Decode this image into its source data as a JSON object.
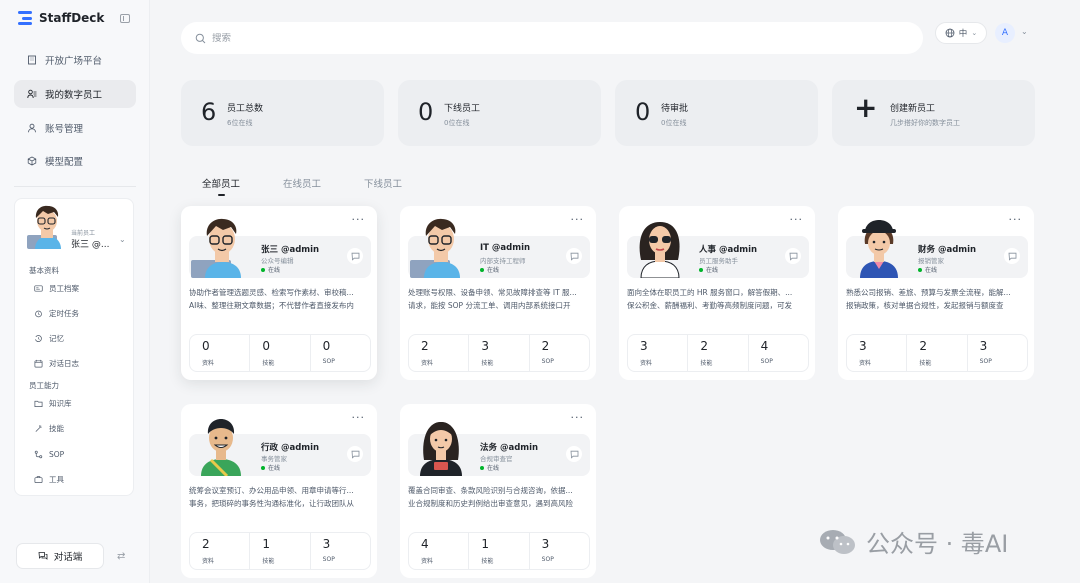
{
  "brand": {
    "name": "StaffDeck"
  },
  "sidebar": {
    "nav": [
      {
        "label": "开放广场平台",
        "icon": "building-icon",
        "active": false
      },
      {
        "label": "我的数字员工",
        "icon": "users-icon",
        "active": true
      },
      {
        "label": "账号管理",
        "icon": "user-icon",
        "active": false
      },
      {
        "label": "模型配置",
        "icon": "cube-icon",
        "active": false
      }
    ],
    "employee": {
      "subtitle": "当前员工",
      "name": "张三 @...",
      "group1": "基本资料",
      "group1_items": [
        "员工档案",
        "定时任务",
        "记忆",
        "对话日志"
      ],
      "group2": "员工能力",
      "group2_items": [
        "知识库",
        "技能",
        "SOP",
        "工具"
      ]
    },
    "chat_button": "对话端"
  },
  "search": {
    "placeholder": "搜索"
  },
  "header": {
    "lang": "中",
    "avatar": "A"
  },
  "stats": [
    {
      "value": "6",
      "label": "员工总数",
      "sub": "6位在线"
    },
    {
      "value": "0",
      "label": "下线员工",
      "sub": "0位在线"
    },
    {
      "value": "0",
      "label": "待审批",
      "sub": "0位在线"
    }
  ],
  "create": {
    "label": "创建新员工",
    "sub": "几步搭好你的数字员工"
  },
  "tabs": [
    "全部员工",
    "在线员工",
    "下线员工"
  ],
  "card_stat_labels": [
    "资料",
    "技能",
    "SOP"
  ],
  "cards": [
    {
      "name": "张三 @admin",
      "role": "公众号编辑",
      "status": "在线",
      "desc": [
        "协助作者管理选题灵感、检索写作素材、审校稿...",
        "AI味、整理往期文章数据；不代替作者直接发布内"
      ],
      "stats": [
        "0",
        "0",
        "0"
      ]
    },
    {
      "name": "IT @admin",
      "role": "内部支持工程师",
      "status": "在线",
      "desc": [
        "处理账号权限、设备申领、常见故障排查等 IT 服...",
        "请求，能按 SOP 分流工单、调用内部系统接口开"
      ],
      "stats": [
        "2",
        "3",
        "2"
      ]
    },
    {
      "name": "人事 @admin",
      "role": "员工服务助手",
      "status": "在线",
      "desc": [
        "面向全体在职员工的 HR 服务窗口，解答假期、...",
        "保公积金、薪酬福利、考勤等高频制度问题，可发"
      ],
      "stats": [
        "3",
        "2",
        "4"
      ]
    },
    {
      "name": "财务 @admin",
      "role": "报销管家",
      "status": "在线",
      "desc": [
        "熟悉公司报销、差旅、预算与发票全流程，能解...",
        "报销政策，核对单据合规性，发起报销与额度查"
      ],
      "stats": [
        "3",
        "2",
        "3"
      ]
    },
    {
      "name": "行政 @admin",
      "role": "事务管家",
      "status": "在线",
      "desc": [
        "统筹会议室预订、办公用品申领、用章申请等行...",
        "事务，把琐碎的事务性沟通标准化，让行政团队从"
      ],
      "stats": [
        "2",
        "1",
        "3"
      ]
    },
    {
      "name": "法务 @admin",
      "role": "合规审查官",
      "status": "在线",
      "desc": [
        "覆盖合同审查、条款风险识别与合规咨询，依据...",
        "业合规制度和历史判例给出审查意见，遇到高风险"
      ],
      "stats": [
        "4",
        "1",
        "3"
      ]
    }
  ],
  "watermark": {
    "text": "公众号 · 毒AI"
  }
}
